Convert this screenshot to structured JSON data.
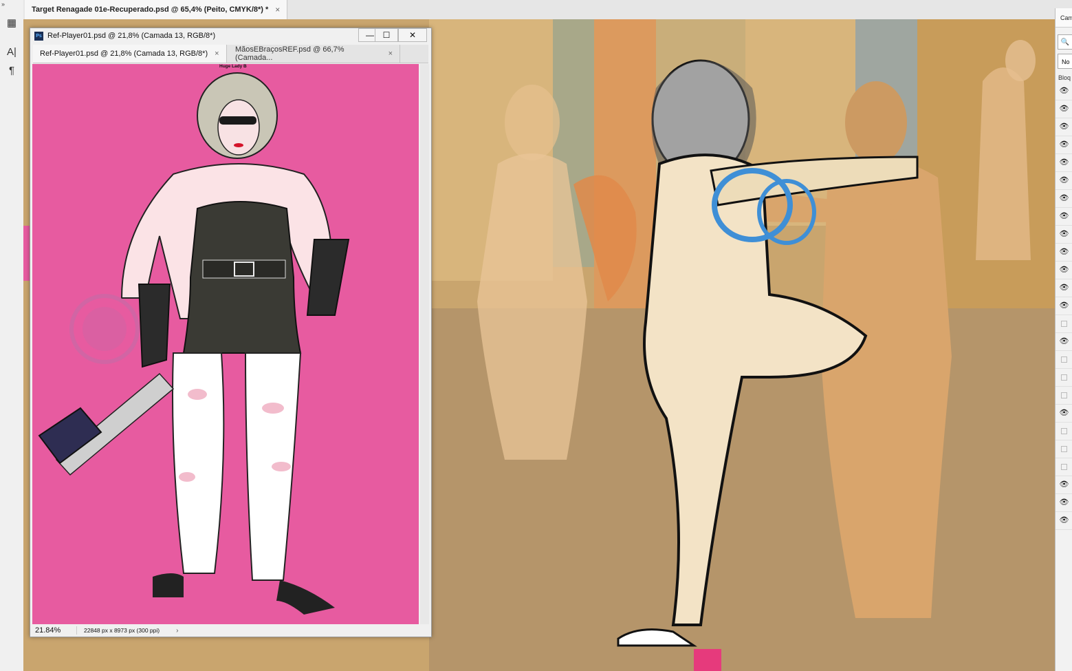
{
  "document": {
    "tab_title": "Target Renagade 01e-Recuperado.psd @ 65,4% (Peito, CMYK/8*) *",
    "close_glyph": "×"
  },
  "toolstrip": {
    "expand_glyph": "»",
    "tools": [
      {
        "name": "grid-icon",
        "glyph": "▦"
      },
      {
        "name": "character-icon",
        "glyph": "A|"
      },
      {
        "name": "paragraph-icon",
        "glyph": "¶"
      }
    ]
  },
  "layers_panel": {
    "header_label": "Cam",
    "search_glyph": "🔍",
    "filter_label": "No",
    "lock_label": "Bloq",
    "eye_glyph": "👁",
    "rows": [
      true,
      true,
      true,
      true,
      true,
      true,
      true,
      true,
      true,
      true,
      true,
      true,
      true,
      false,
      true,
      false,
      false,
      false,
      true,
      false,
      false,
      false,
      true,
      true,
      true
    ]
  },
  "floating_window": {
    "title": "Ref-Player01.psd @ 21,8% (Camada 13, RGB/8*)",
    "minimize_glyph": "—",
    "maximize_glyph": "☐",
    "close_glyph": "✕",
    "tabs": [
      {
        "label": "Ref-Player01.psd @ 21,8% (Camada 13, RGB/8*)",
        "close": "×"
      },
      {
        "label": "MãosEBraçosREF.psd @ 66,7% (Camada...",
        "close": "×"
      }
    ],
    "reference_caption": "Huge Lady B",
    "status": {
      "zoom": "21.84%",
      "dimensions": "22848 px x 8973 px (300 ppi)",
      "arrow_glyph": "›"
    }
  },
  "colors": {
    "reference_bg": "#e75ba0",
    "canvas_bg": "#c9a56e"
  }
}
